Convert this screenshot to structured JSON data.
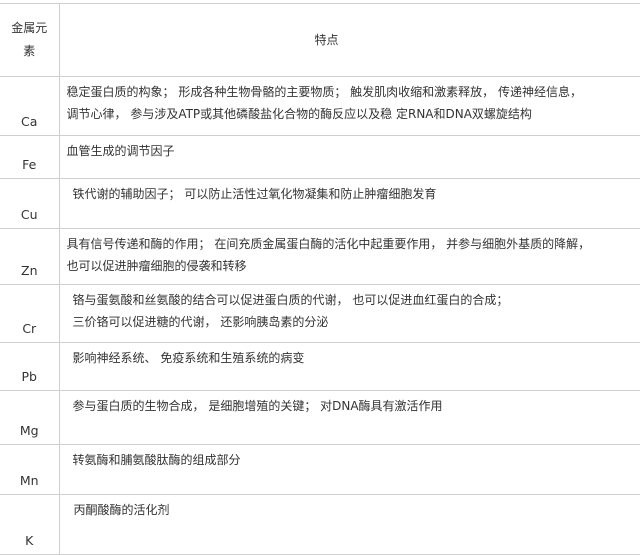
{
  "table": {
    "headers": {
      "element": "金属元\n素",
      "features": "特点"
    },
    "rows": [
      {
        "element": "Ca",
        "features": "稳定蛋白质的构象； 形成各种生物骨骼的主要物质； 触发肌肉收缩和激素释放， 传递神经信息，\n调节心律， 参与涉及ATP或其他磷酸盐化合物的酶反应以及稳 定RNA和DNA双螺旋结构"
      },
      {
        "element": "Fe",
        "features": "血管生成的调节因子"
      },
      {
        "element": "Cu",
        "features": "铁代谢的辅助因子； 可以防止活性过氧化物凝集和防止肿瘤细胞发育"
      },
      {
        "element": "Zn",
        "features": "具有信号传递和酶的作用； 在间充质金属蛋白酶的活化中起重要作用， 并参与细胞外基质的降解，\n也可以促进肿瘤细胞的侵袭和转移"
      },
      {
        "element": "Cr",
        "features": "铬与蛋氨酸和丝氨酸的结合可以促进蛋白质的代谢， 也可以促进血红蛋白的合成；\n三价铬可以促进糖的代谢， 还影响胰岛素的分泌"
      },
      {
        "element": "Pb",
        "features": "影响神经系统、 免疫系统和生殖系统的病变"
      },
      {
        "element": "Mg",
        "features": "参与蛋白质的生物合成， 是细胞增殖的关键； 对DNA酶具有激活作用"
      },
      {
        "element": "Mn",
        "features": "转氨酶和脯氨酸肽酶的组成部分"
      },
      {
        "element": "K",
        "features": "丙酮酸酶的活化剂"
      }
    ]
  }
}
